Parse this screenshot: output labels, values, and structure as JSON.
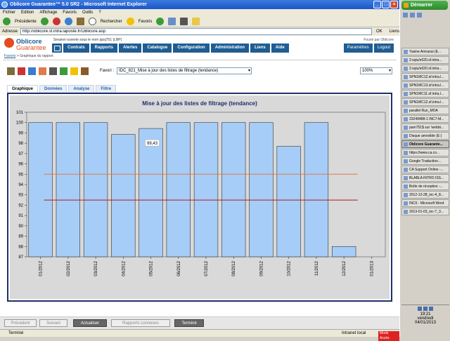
{
  "window": {
    "title": "Oblicore Guarantee™ 5.0 SR2 - Microsoft Internet Explorer"
  },
  "menu": [
    "Fichier",
    "Edition",
    "Affichage",
    "Favoris",
    "Outils",
    "?"
  ],
  "toolbar": {
    "back": "Précédente",
    "search": "Rechercher",
    "favorites": "Favoris"
  },
  "address": {
    "label": "Adresse",
    "url": "http://oblicore.sf.intra.laposte.fr/OBlicore.asp",
    "go": "OK",
    "links": "Liens"
  },
  "header": {
    "logo_line1": "Oblicore",
    "logo_line2": "Guarantee",
    "session": "Session ouverte sous le nom ppsj751 (LBP)",
    "provided": "Fourni par Oblicore",
    "nav": [
      "Contrats",
      "Rapports",
      "Alertes",
      "Catalogue",
      "Configuration",
      "Administration",
      "Liens",
      "Aide"
    ],
    "user_nav": [
      "Paramètres",
      "Logout"
    ]
  },
  "breadcrumb": {
    "link": "Favoris",
    "current": "> Graphique du rapport"
  },
  "report": {
    "favorite_label": "Favori :",
    "favorite_value": "IDC_821_Mise à jour des listes de filtrage (tendance)",
    "zoom_value": "100%"
  },
  "tabs": [
    "Graphique",
    "Données",
    "Analyse",
    "Filtre"
  ],
  "chart_data": {
    "type": "bar",
    "title": "Mise à jour des listes de filtrage (tendance)",
    "categories": [
      "01/2012",
      "02/2012",
      "03/2012",
      "04/2012",
      "05/2012",
      "06/2012",
      "07/2012",
      "08/2012",
      "09/2012",
      "10/2012",
      "11/2012",
      "12/2012",
      "01/2013"
    ],
    "values": [
      100,
      100,
      100,
      98.85,
      99.43,
      100,
      100,
      100,
      100,
      97.7,
      100,
      88,
      null
    ],
    "data_labels": [
      {
        "index": 4,
        "text": "99,43"
      }
    ],
    "ylim": [
      87,
      101
    ],
    "yticks": [
      87,
      88,
      89,
      90,
      91,
      92,
      93,
      94,
      95,
      96,
      97,
      98,
      99,
      100,
      101
    ],
    "reference_lines": [
      {
        "value": 95,
        "color": "#e07a4a"
      },
      {
        "value": 92.5,
        "color": "#b01818"
      }
    ],
    "bar_color": "#a6cdf7",
    "grid": "none"
  },
  "buttons": [
    "Précédent",
    "Suivant",
    "Actualiser",
    "Rapports connexes",
    "Terminé"
  ],
  "status": {
    "left": "Terminé",
    "zone": "Intranet local",
    "badge": "Mode Accès"
  },
  "taskbar": {
    "start": "Démarrer",
    "items": [
      "Yasine Amraoui (E...",
      "2:sqiu/e020.sf.intra...",
      "2:sqiu/e020.sf.intra...",
      "SPN1MC12.sf.intra.l...",
      "SPN1MC13.sf.intra.l...",
      "SPN1MC11.sf.intra.l...",
      "SPN1MC12.sf.intra.l...",
      "parallel Run_MOA",
      "23249488-1 INC7-M...",
      "pam751$ sur 'webbt...",
      "Disque amovible (E:)",
      "Oblicore Guarante...",
      "https://www.ca.co...",
      "Google Traduction...",
      "CA Support Online -...",
      "BLABLA INTRO ISS...",
      "Boîte de réception -...",
      "2012-12-28_inc-4_8...",
      "INC6 - Microsoft Word",
      "2013-01-03_inc-7_3..."
    ],
    "active_index": 11,
    "clock": "19:21",
    "day": "vendredi",
    "date": "04/01/2013"
  }
}
